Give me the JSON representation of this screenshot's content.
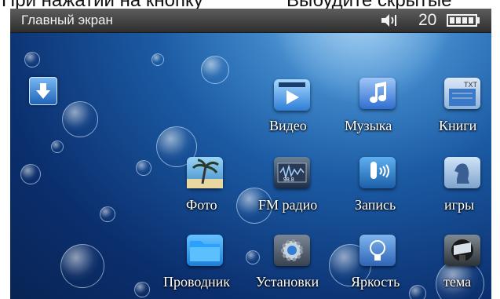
{
  "caption": {
    "left": "При нажатии на кнопку",
    "right": "Выбудите скрытые"
  },
  "status_bar": {
    "title": "Главный экран",
    "volume": "20"
  },
  "apps": [
    {
      "label": "Видео",
      "icon": "video-icon"
    },
    {
      "label": "Музыка",
      "icon": "music-note-icon"
    },
    {
      "label": "Книги",
      "icon": "txt-book-icon"
    },
    {
      "label": "Фото",
      "icon": "palm-photo-icon"
    },
    {
      "label": "FM радио",
      "icon": "radio-icon"
    },
    {
      "label": "Запись",
      "icon": "microphone-icon"
    },
    {
      "label": "игры",
      "icon": "chess-knight-icon"
    },
    {
      "label": "Проводник",
      "icon": "folder-icon"
    },
    {
      "label": "Установки",
      "icon": "gear-icon"
    },
    {
      "label": "Яркость",
      "icon": "lightbulb-icon"
    },
    {
      "label": "тема",
      "icon": "theme-icon"
    }
  ],
  "colors": {
    "status_bar": "#3a3a3a",
    "background": "#1b5aa3",
    "label": "#ffffff"
  }
}
